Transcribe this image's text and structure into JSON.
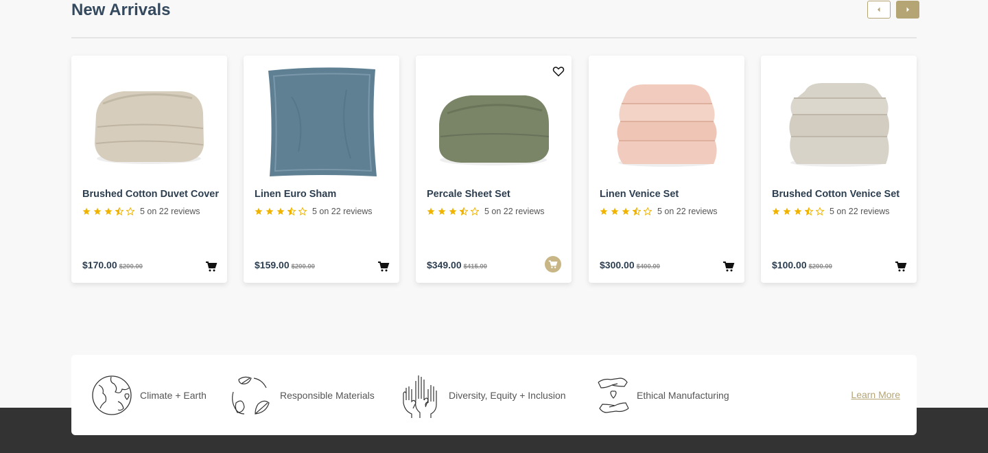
{
  "section": {
    "title": "New Arrivals",
    "prev_icon": "chevron-left-icon",
    "next_icon": "chevron-right-icon"
  },
  "products": [
    {
      "name": "Brushed Cotton Duvet Cover",
      "rating_text": "5 on 22 reviews",
      "rating": 3.5,
      "price": "$170.00",
      "old_price": "$200.00",
      "color": "#d6cdbd"
    },
    {
      "name": "Linen Euro Sham",
      "rating_text": "5 on 22 reviews",
      "rating": 3.5,
      "price": "$159.00",
      "old_price": "$200.00",
      "color": "#5f7f93"
    },
    {
      "name": "Percale Sheet Set",
      "rating_text": "5 on 22 reviews",
      "rating": 3.5,
      "price": "$349.00",
      "old_price": "$415.00",
      "color": "#7a8466"
    },
    {
      "name": "Linen Venice Set",
      "rating_text": "5 on 22 reviews",
      "rating": 3.5,
      "price": "$300.00",
      "old_price": "$400.00",
      "color": "#f1cbbd"
    },
    {
      "name": "Brushed Cotton Venice Set",
      "rating_text": "5 on 22 reviews",
      "rating": 3.5,
      "price": "$100.00",
      "old_price": "$200.00",
      "color": "#d8d3c8"
    }
  ],
  "values": [
    {
      "label": "Climate + Earth",
      "icon": "globe-heart-icon"
    },
    {
      "label": "Responsible Materials",
      "icon": "leaf-cycle-icon"
    },
    {
      "label": "Diversity, Equity + Inclusion",
      "icon": "raised-hands-icon"
    },
    {
      "label": "Ethical Manufacturing",
      "icon": "hands-heart-icon"
    }
  ],
  "learn_more": "Learn More",
  "colors": {
    "accent": "#b5a574",
    "star": "#f0b400",
    "text": "#2c3e50",
    "footer": "#333333"
  }
}
